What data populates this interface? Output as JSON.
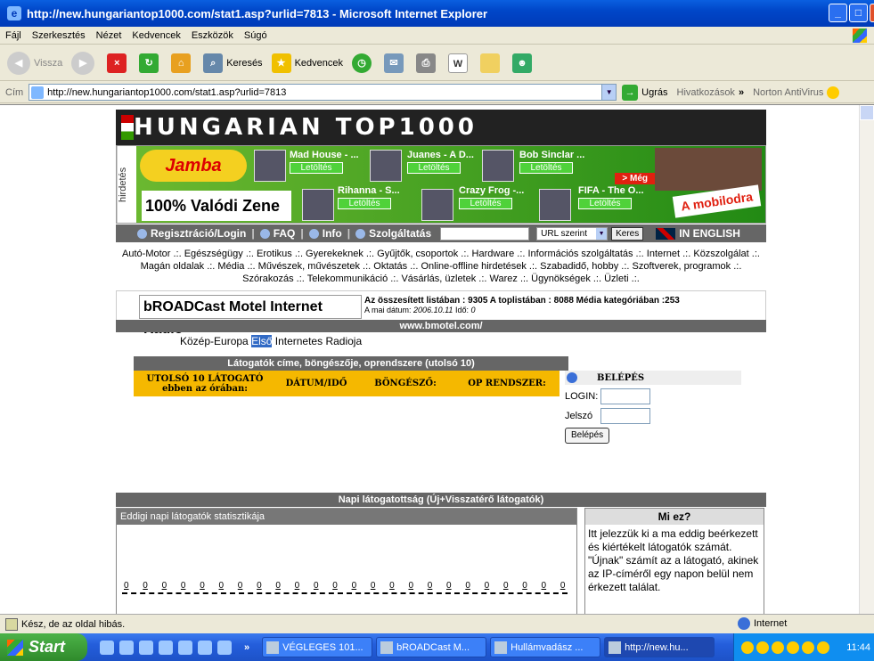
{
  "window": {
    "title": "http://new.hungariantop1000.com/stat1.asp?urlid=7813 - Microsoft Internet Explorer",
    "min": "_",
    "max": "□",
    "close": "X"
  },
  "menu": [
    "Fájl",
    "Szerkesztés",
    "Nézet",
    "Kedvencek",
    "Eszközök",
    "Súgó"
  ],
  "toolbar": {
    "back": "Vissza",
    "search": "Keresés",
    "favorites": "Kedvencek"
  },
  "address": {
    "label": "Cím",
    "url": "http://new.hungariantop1000.com/stat1.asp?urlid=7813",
    "go": "Ugrás",
    "links": "Hivatkozások",
    "chevron": "»",
    "norton": "Norton AntiVirus"
  },
  "page": {
    "site_title": "HUNGARIAN TOP1000",
    "ad": {
      "side": "hirdetés",
      "brand": "Jamba",
      "slogan": "100% Valódi Zene",
      "more": "> Még",
      "mobil": "A mobilodra",
      "songs": [
        {
          "title": "Mad House - ...",
          "dl": "Letöltés"
        },
        {
          "title": "Juanes - A D...",
          "dl": "Letöltés"
        },
        {
          "title": "Bob Sinclar ...",
          "dl": "Letöltés"
        },
        {
          "title": "Rihanna - S...",
          "dl": "Letöltés"
        },
        {
          "title": "Crazy Frog -...",
          "dl": "Letöltés"
        },
        {
          "title": "FIFA - The O...",
          "dl": "Letöltés"
        }
      ]
    },
    "nav": {
      "register": "Regisztráció/Login",
      "faq": "FAQ",
      "info": "Info",
      "services": "Szolgáltatás",
      "select": "URL szerint",
      "search_btn": "Keres",
      "english": "IN ENGLISH"
    },
    "categories": "Autó-Motor .:. Egészségügy .:. Erotikus .:. Gyerekeknek .:. Gyűjtők, csoportok .:. Hardware .:. Információs szolgáltatás .:. Internet .:. Közszolgálat .:. Magán oldalak .:. Média .:. Művészek, művészetek .:. Oktatás .:. Online-offline hirdetések .:. Szabadidő, hobby .:. Szoftverek, programok .:. Szórakozás .:. Telekommunikáció .:. Vásárlás, üzletek .:. Warez .:. Ügynökségek .:. Üzleti .:.",
    "radio": {
      "name": "bROADCast Motel Internet Radio",
      "stats": "Az összesített listában : 9305   A toplistában : 8088 Média kategóriában :253",
      "date_label": "A mai dátum:",
      "date": "2006.10.11",
      "time_label": "Idő:",
      "time": "0",
      "url": "www.bmotel.com/"
    },
    "slogan_pre": "Közép-Europa ",
    "slogan_hl": "Első",
    "slogan_post": " Internetes Radioja",
    "visitors": {
      "title": "Látogatók címe, böngészője, oprendszere (utolsó 10)",
      "col1a": "UTOLSÓ 10 LÁTOGATÓ",
      "col1b": "ebben az órában:",
      "col2": "DÁTUM/IDŐ",
      "col3": "BÖNGÉSZŐ:",
      "col4": "OP RENDSZER:"
    },
    "login": {
      "title": "BELÉPÉS",
      "login_label": "LOGIN:",
      "pass_label": "Jelszó",
      "button": "Belépés"
    },
    "daily": {
      "title": "Napi látogatottság (Új+Visszatérő látogatók)",
      "stats_title": "Eddigi napi látogatók statisztikája",
      "zeros": [
        "0",
        "0",
        "0",
        "0",
        "0",
        "0",
        "0",
        "0",
        "0",
        "0",
        "0",
        "0",
        "0",
        "0",
        "0",
        "0",
        "0",
        "0",
        "0",
        "0",
        "0",
        "0",
        "0",
        "0"
      ]
    },
    "miez": {
      "title": "Mi ez?",
      "text": "Itt jelezzük ki a ma eddig beérkezett és kiértékelt látogatók számát. \"Újnak\" számít az a látogató, akinek az IP-címéről egy napon belül nem érkezett találat."
    }
  },
  "status": {
    "text": "Kész, de az oldal hibás.",
    "zone": "Internet"
  },
  "taskbar": {
    "start": "Start",
    "chevron": "»",
    "tasks": [
      "VÉGLEGES 101...",
      "bROADCast M...",
      "Hullámvadász ...",
      "http://new.hu..."
    ],
    "clock": "11:44"
  }
}
